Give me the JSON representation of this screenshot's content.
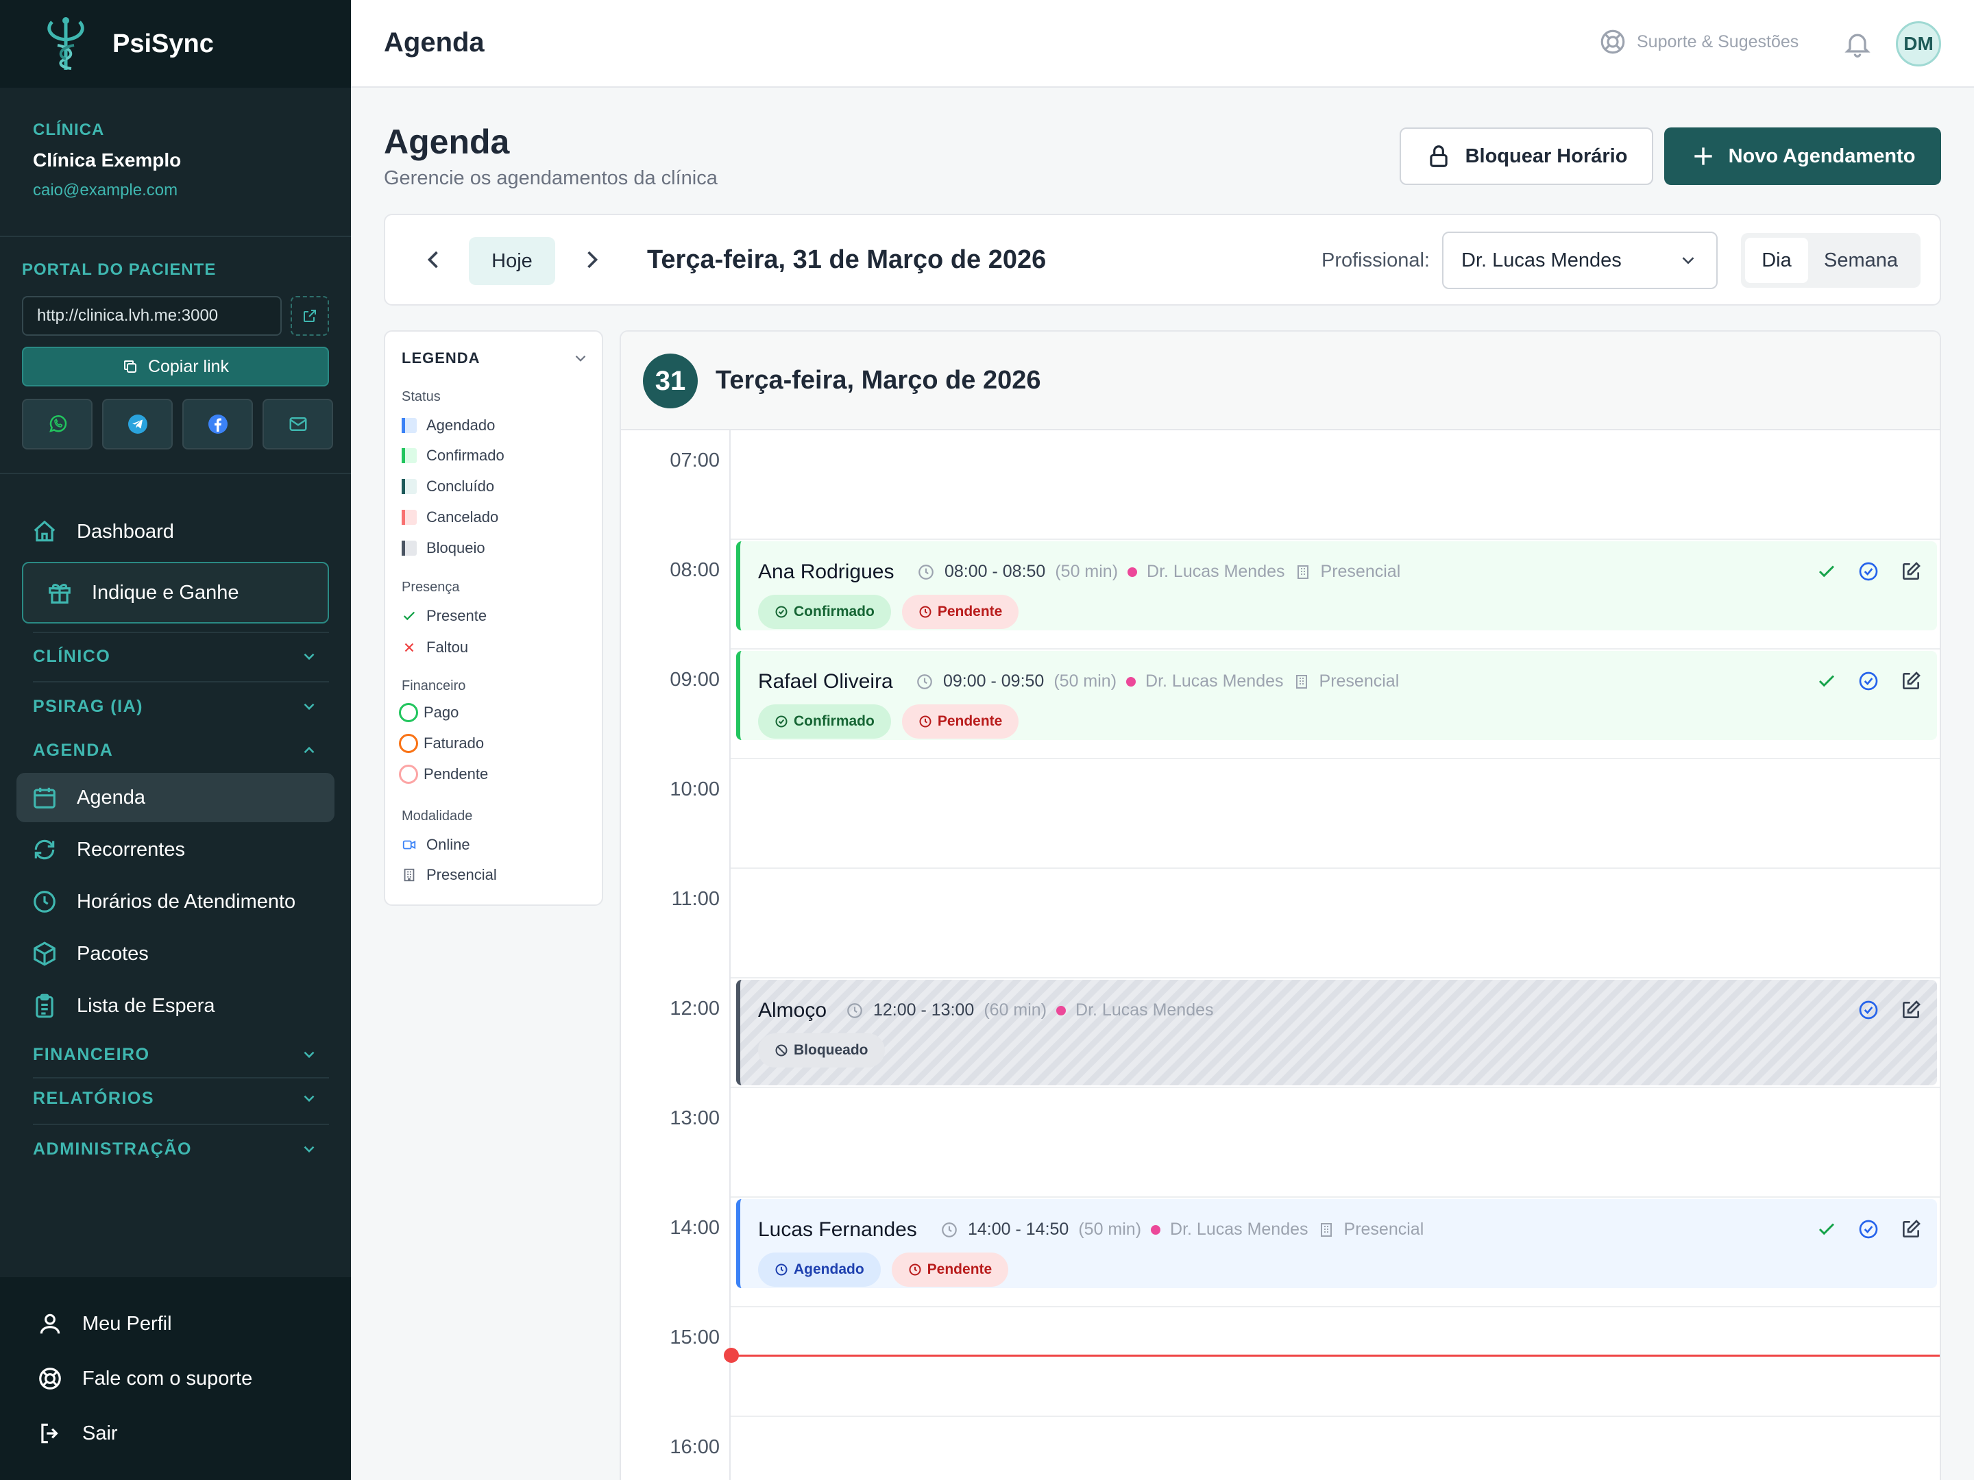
{
  "brand": "PsiSync",
  "clinic": {
    "label": "CLÍNICA",
    "name": "Clínica Exemplo",
    "email": "caio@example.com"
  },
  "portal": {
    "label": "PORTAL DO PACIENTE",
    "url": "http://clinica.lvh.me:3000",
    "copy": "Copiar link"
  },
  "nav": {
    "dashboard": "Dashboard",
    "indique": "Indique e Ganhe",
    "clinico": "CLÍNICO",
    "psirag": "PSIRAG (IA)",
    "agenda_sec": "AGENDA",
    "agenda": "Agenda",
    "recorrentes": "Recorrentes",
    "horarios": "Horários de Atendimento",
    "pacotes": "Pacotes",
    "espera": "Lista de Espera",
    "financeiro": "FINANCEIRO",
    "relatorios": "RELATÓRIOS",
    "admin": "ADMINISTRAÇÃO",
    "perfil": "Meu Perfil",
    "suporte": "Fale com o suporte",
    "sair": "Sair"
  },
  "topbar": {
    "title": "Agenda",
    "support": "Suporte & Sugestões",
    "avatar": "DM"
  },
  "page": {
    "title": "Agenda",
    "subtitle": "Gerencie os agendamentos da clínica",
    "block_btn": "Bloquear Horário",
    "new_btn": "Novo Agendamento"
  },
  "datebar": {
    "today": "Hoje",
    "date": "Terça-feira, 31 de Março de 2026",
    "prof_label": "Profissional:",
    "prof": "Dr. Lucas Mendes",
    "view_day": "Dia",
    "view_week": "Semana"
  },
  "legend": {
    "title": "LEGENDA",
    "status": "Status",
    "agendado": "Agendado",
    "confirmado": "Confirmado",
    "concluido": "Concluído",
    "cancelado": "Cancelado",
    "bloqueio": "Bloqueio",
    "presenca": "Presença",
    "presente": "Presente",
    "faltou": "Faltou",
    "financeiro": "Financeiro",
    "pago": "Pago",
    "faturado": "Faturado",
    "pendente": "Pendente",
    "modalidade": "Modalidade",
    "online": "Online",
    "presencial": "Presencial"
  },
  "calendar": {
    "day": "31",
    "title": "Terça-feira, Março de 2026",
    "hours": [
      "07:00",
      "08:00",
      "09:00",
      "10:00",
      "11:00",
      "12:00",
      "13:00",
      "14:00",
      "15:00",
      "16:00"
    ]
  },
  "appointments": [
    {
      "name": "Ana Rodrigues",
      "time": "08:00 - 08:50",
      "dur": "(50 min)",
      "prof": "Dr. Lucas Mendes",
      "mode": "Presencial",
      "status": "Confirmado",
      "fin": "Pendente"
    },
    {
      "name": "Rafael Oliveira",
      "time": "09:00 - 09:50",
      "dur": "(50 min)",
      "prof": "Dr. Lucas Mendes",
      "mode": "Presencial",
      "status": "Confirmado",
      "fin": "Pendente"
    },
    {
      "name": "Almoço",
      "time": "12:00 - 13:00",
      "dur": "(60 min)",
      "prof": "Dr. Lucas Mendes",
      "status": "Bloqueado"
    },
    {
      "name": "Lucas Fernandes",
      "time": "14:00 - 14:50",
      "dur": "(50 min)",
      "prof": "Dr. Lucas Mendes",
      "mode": "Presencial",
      "status": "Agendado",
      "fin": "Pendente"
    }
  ],
  "colors": {
    "accent": "#1e5a5a",
    "teal": "#3fb7b0",
    "confirmed": "#22c55e",
    "scheduled": "#3b82f6",
    "now": "#ef4444"
  }
}
